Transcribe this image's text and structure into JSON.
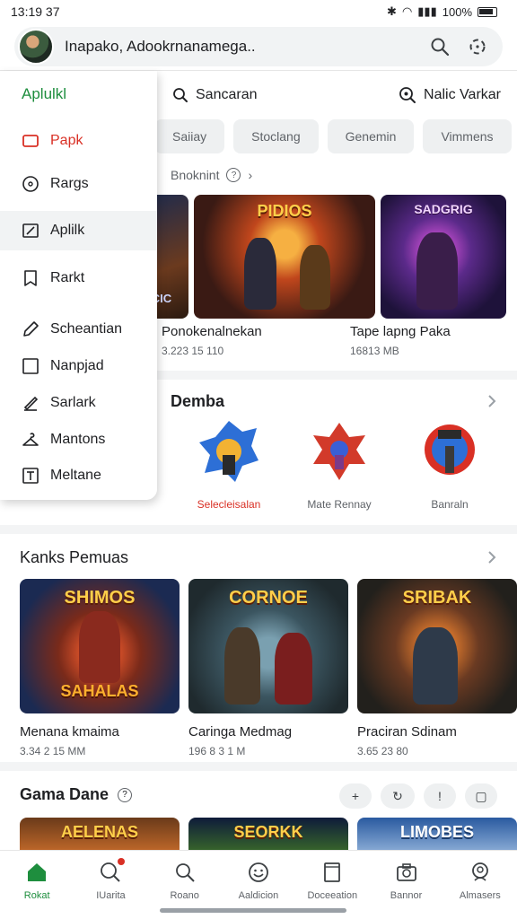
{
  "status": {
    "time": "13:19 37",
    "battery": "100%"
  },
  "search": {
    "text": "Inapako, Adookrnanamega.."
  },
  "drawer": {
    "title": "Aplulkl",
    "items": [
      {
        "label": "Papk",
        "icon": "card-icon"
      },
      {
        "label": "Rargs",
        "icon": "compass-icon"
      },
      {
        "label": "Aplilk",
        "icon": "apps-icon"
      },
      {
        "label": "Rarkt",
        "icon": "bookmark-icon"
      },
      {
        "label": "Scheantian",
        "icon": "pen-icon"
      },
      {
        "label": "Nanpjad",
        "icon": "square-icon"
      },
      {
        "label": "Sarlark",
        "icon": "edit-icon"
      },
      {
        "label": "Mantons",
        "icon": "hanger-icon"
      },
      {
        "label": "Meltane",
        "icon": "tag-icon"
      }
    ]
  },
  "toprow": {
    "search_label": "Sancaran",
    "right_label": "Nalic Varkar"
  },
  "chips": [
    "Saiiay",
    "Stoclang",
    "Genemin",
    "Vimmens"
  ],
  "crumb": {
    "label": "Bnoknint",
    "help": "?"
  },
  "features": {
    "titles": [
      "CIC",
      "PIDIOS",
      "SADGRIG"
    ],
    "items": [
      {
        "title": "Ponokenalnekan",
        "sub": "3.223 15 110"
      },
      {
        "title": "Tape lapng Paka",
        "sub": "16813 MB"
      }
    ]
  },
  "demba": {
    "title": "Demba",
    "emblems": [
      {
        "label": "Selecleisalan",
        "accent": "#d93025"
      },
      {
        "label": "Mate Rennay"
      },
      {
        "label": "Banraln"
      }
    ]
  },
  "kanks": {
    "title": "Kanks Pemuas",
    "cards": [
      {
        "banner": "SHIMOS",
        "sub": "SAHALAS",
        "title": "Menana kmaima",
        "sub2": "3.34 2 15 MM"
      },
      {
        "banner": "CORNOE",
        "sub": "",
        "title": "Caringa Medmag",
        "sub2": "196 8 3 1 M"
      },
      {
        "banner": "SRIBAK",
        "sub": "",
        "title": "Praciran Sdinam",
        "sub2": "3.65 23 80"
      }
    ]
  },
  "game": {
    "title": "Gama Dane",
    "help": "?",
    "pills": [
      "+",
      "↻",
      "!",
      "▢"
    ],
    "strip": [
      "AELENAS",
      "SEORKK",
      "LIMOBES"
    ]
  },
  "bottom_nav": [
    {
      "label": "Rokat",
      "icon": "home-icon",
      "active": true
    },
    {
      "label": "IUarita",
      "icon": "search-icon",
      "badge": true
    },
    {
      "label": "Roano",
      "icon": "magnifier-icon"
    },
    {
      "label": "Aaldicion",
      "icon": "smiley-icon"
    },
    {
      "label": "Doceeation",
      "icon": "document-icon"
    },
    {
      "label": "Bannor",
      "icon": "camera-icon"
    },
    {
      "label": "Almasers",
      "icon": "person-icon"
    }
  ],
  "colors": {
    "accent_green": "#1e8e3e",
    "accent_red": "#d93025"
  }
}
